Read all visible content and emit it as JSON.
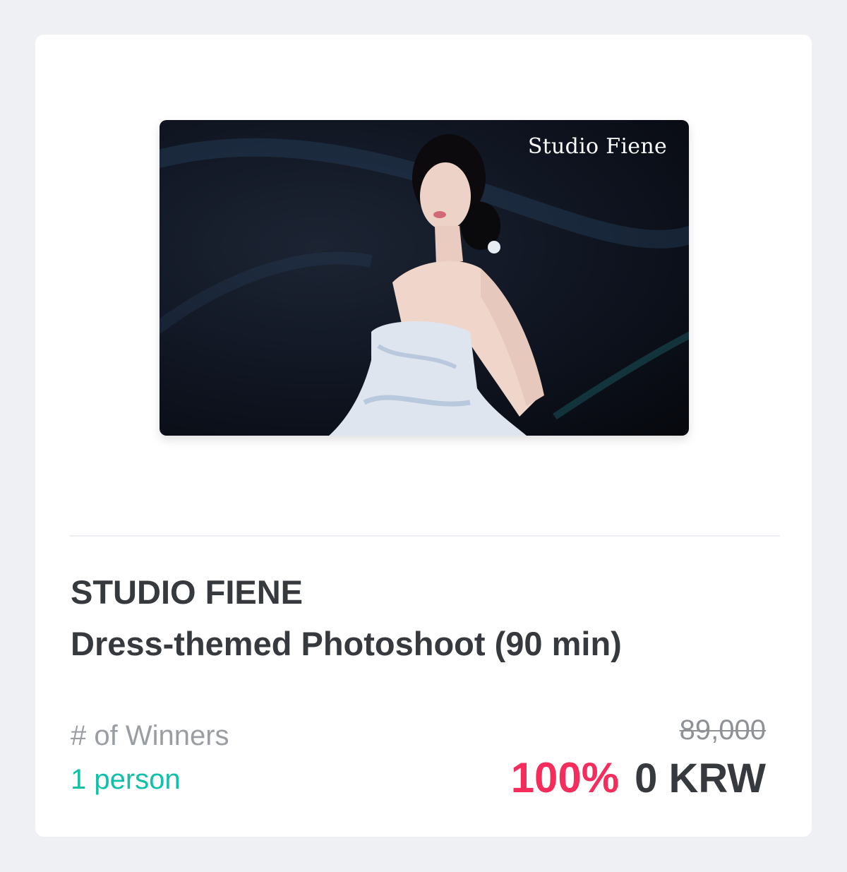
{
  "product": {
    "image_watermark": "Studio Fiene",
    "brand": "STUDIO FIENE",
    "name": "Dress-themed Photoshoot (90 min)"
  },
  "winners": {
    "label": "# of Winners",
    "value": "1 person"
  },
  "pricing": {
    "original_price": "89,000",
    "discount": "100%",
    "final_price": "0 KRW"
  },
  "colors": {
    "accent_teal": "#12bfa8",
    "accent_pink": "#f52d5c",
    "text_dark": "#36393d",
    "text_muted": "#9a9ea3",
    "page_background": "#eef0f3"
  }
}
